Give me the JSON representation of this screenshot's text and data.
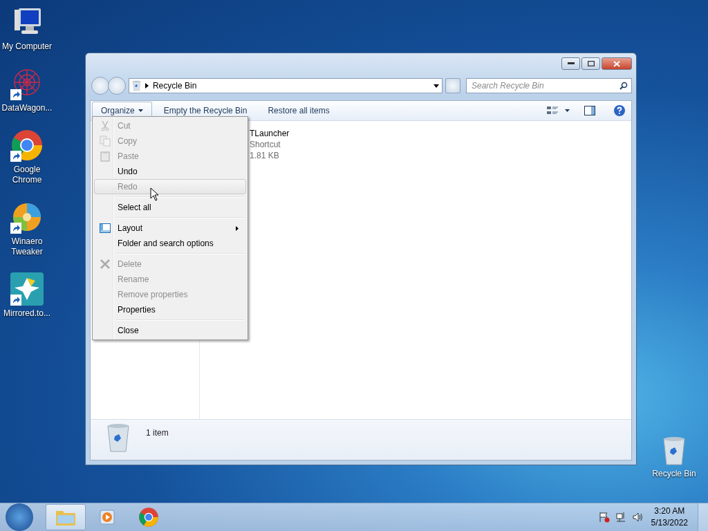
{
  "desktop_icons": [
    {
      "label": "My Computer",
      "shortcut": false
    },
    {
      "label": "DataWagon...",
      "shortcut": true
    },
    {
      "label": "Google Chrome",
      "shortcut": true
    },
    {
      "label": "Winaero Tweaker",
      "shortcut": true
    },
    {
      "label": "Mirrored.to...",
      "shortcut": true
    }
  ],
  "desktop_recycle_bin": {
    "label": "Recycle Bin"
  },
  "window": {
    "address": "Recycle Bin",
    "search": {
      "placeholder": "Search Recycle Bin"
    },
    "toolbar": {
      "organize": "Organize",
      "buttons": [
        "Empty the Recycle Bin",
        "Restore all items"
      ]
    },
    "files": [
      {
        "name": "TLauncher",
        "type": "Shortcut",
        "size": "1.81 KB"
      }
    ],
    "status": "1 item"
  },
  "organize_menu": {
    "groups": [
      [
        {
          "label": "Cut",
          "disabled": true,
          "hovered": false,
          "submenu": false
        },
        {
          "label": "Copy",
          "disabled": true,
          "hovered": false,
          "submenu": false
        },
        {
          "label": "Paste",
          "disabled": true,
          "hovered": false,
          "submenu": false
        },
        {
          "label": "Undo",
          "disabled": false,
          "hovered": false,
          "submenu": false
        },
        {
          "label": "Redo",
          "disabled": true,
          "hovered": true,
          "submenu": false
        }
      ],
      [
        {
          "label": "Select all",
          "disabled": false,
          "hovered": false,
          "submenu": false
        }
      ],
      [
        {
          "label": "Layout",
          "disabled": false,
          "hovered": false,
          "submenu": true
        },
        {
          "label": "Folder and search options",
          "disabled": false,
          "hovered": false,
          "submenu": false
        }
      ],
      [
        {
          "label": "Delete",
          "disabled": true,
          "hovered": false,
          "submenu": false
        },
        {
          "label": "Rename",
          "disabled": true,
          "hovered": false,
          "submenu": false
        },
        {
          "label": "Remove properties",
          "disabled": true,
          "hovered": false,
          "submenu": false
        },
        {
          "label": "Properties",
          "disabled": false,
          "hovered": false,
          "submenu": false
        }
      ],
      [
        {
          "label": "Close",
          "disabled": false,
          "hovered": false,
          "submenu": false
        }
      ]
    ]
  },
  "taskbar": {
    "items": [
      {
        "selected": true
      },
      {
        "selected": false
      },
      {
        "selected": false
      }
    ],
    "time": "3:20 AM",
    "date": "5/13/2022"
  }
}
